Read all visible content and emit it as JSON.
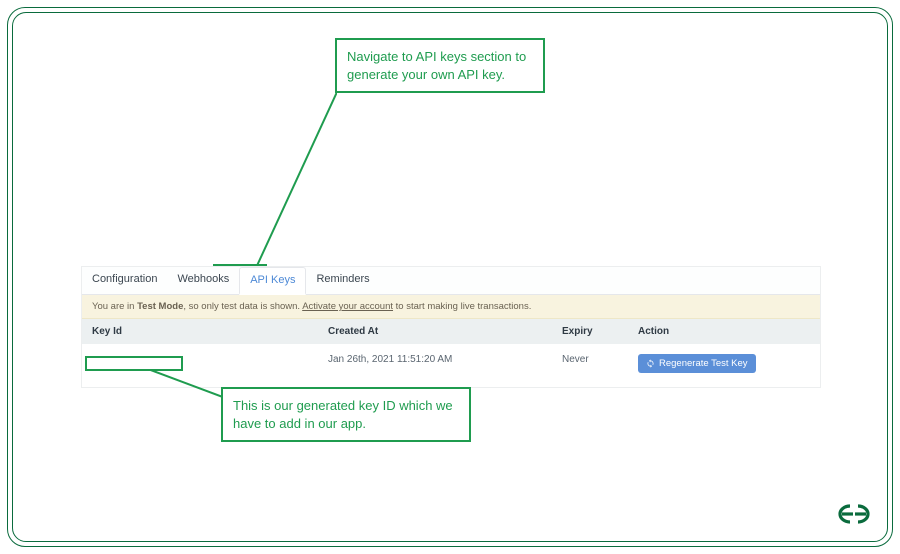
{
  "callouts": {
    "top": "Navigate to API keys section to generate your own API key.",
    "bottom": "This is our generated key ID which we have to add in our app."
  },
  "tabs": {
    "configuration": "Configuration",
    "webhooks": "Webhooks",
    "apikeys": "API Keys",
    "reminders": "Reminders"
  },
  "notice": {
    "prefix": "You are in ",
    "mode": "Test Mode",
    "middle": ", so only test data is shown. ",
    "link": "Activate your account",
    "suffix": " to start making live transactions."
  },
  "table": {
    "headers": {
      "keyid": "Key Id",
      "created": "Created At",
      "expiry": "Expiry",
      "action": "Action"
    },
    "row": {
      "keyid": "",
      "created": "Jan 26th, 2021 11:51:20 AM",
      "expiry": "Never",
      "action_label": "Regenerate Test Key"
    }
  }
}
